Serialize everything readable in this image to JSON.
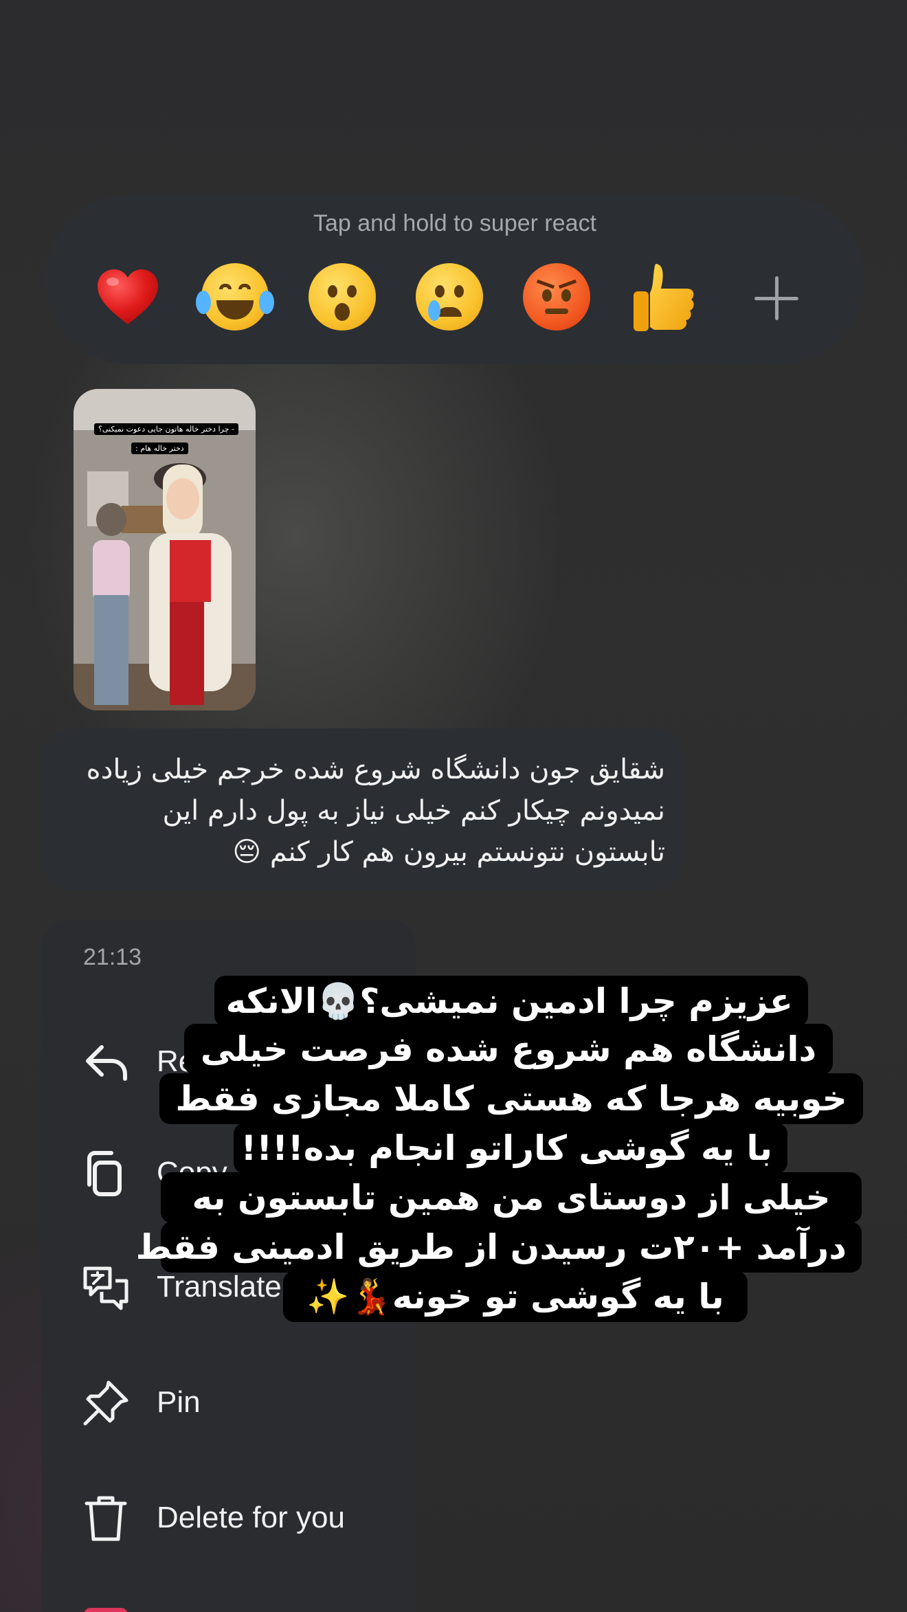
{
  "reactions": {
    "hint": "Tap and hold to super react",
    "emojis": [
      {
        "name": "red-heart",
        "char": "❤️"
      },
      {
        "name": "tears-of-joy",
        "char": "😂"
      },
      {
        "name": "surprised",
        "char": "😮"
      },
      {
        "name": "crying",
        "char": "😢"
      },
      {
        "name": "angry",
        "char": "😡"
      },
      {
        "name": "thumbs-up",
        "char": "👍"
      }
    ],
    "more_icon": "plus-icon"
  },
  "media_message": {
    "caption_line1": "- چرا دختر خاله هاتون جایی دعوت نمیکنی؟",
    "caption_line2": "دختر خاله هام :"
  },
  "text_message": {
    "body": "شقایق جون دانشگاه شروع شده خرجم خیلی زیاده نمیدونم چیکار کنم خیلی نیاز به پول دارم این تابستون نتونستم بیرون هم کار کنم 😔"
  },
  "context_menu": {
    "time": "21:13",
    "items": [
      {
        "label": "Re",
        "icon": "reply-icon"
      },
      {
        "label": "Copy",
        "icon": "copy-icon"
      },
      {
        "label": "Translate",
        "icon": "translate-icon"
      },
      {
        "label": "Pin",
        "icon": "pin-icon"
      },
      {
        "label": "Delete for you",
        "icon": "trash-icon"
      }
    ]
  },
  "overlay": {
    "lines": [
      "عزیزم چرا ادمین نمیشی؟💀الانکه",
      "دانشگاه هم  شروع شده فرصت خیلی",
      "خوبیه هرجا که هستی کاملا مجازی فقط",
      "با یه گوشی کاراتو انجام بده!!!!",
      "خیلی از دوستای من همین تابستون به",
      "درآمد +۲۰ت رسیدن از طریق ادمینی فقط",
      "با یه گوشی تو خونه💃✨"
    ]
  },
  "colors": {
    "bubble": "#2b2e33",
    "menu_bg": "#2a2c30",
    "overlay_bg": "#000000",
    "text_primary": "#f2f2f2",
    "text_secondary": "#a2a5aa"
  }
}
